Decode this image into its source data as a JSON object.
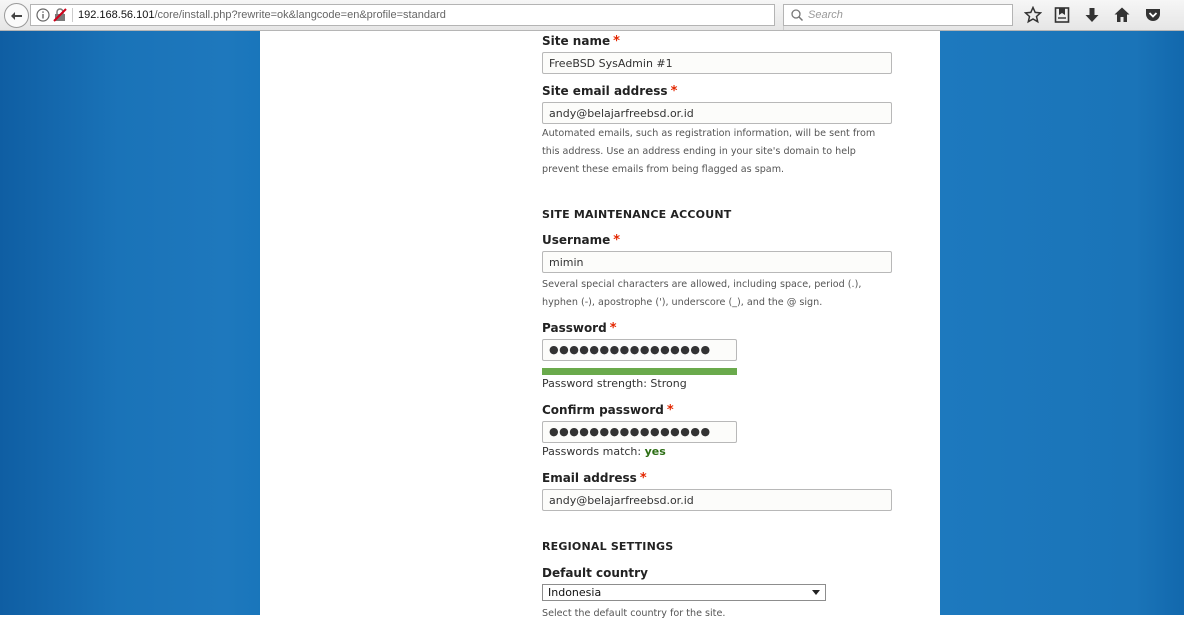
{
  "browser": {
    "url_host": "192.168.56.101",
    "url_path": "/core/install.php?rewrite=ok&langcode=en&profile=standard",
    "search_placeholder": "Search"
  },
  "form": {
    "site_name": {
      "label": "Site name",
      "required_mark": "*",
      "value": "FreeBSD SysAdmin #1"
    },
    "site_email": {
      "label": "Site email address",
      "required_mark": "*",
      "value": "andy@belajarfreebsd.or.id",
      "help_lines": [
        "Automated emails, such as registration information, will be sent from",
        "this address. Use an address ending in your site's domain to help",
        "prevent these emails from being flagged as spam."
      ]
    },
    "maintenance_heading": "SITE MAINTENANCE ACCOUNT",
    "username": {
      "label": "Username",
      "required_mark": "*",
      "value": "mimin",
      "help_lines": [
        "Several special characters are allowed, including space, period (.),",
        "hyphen (-), apostrophe ('), underscore (_), and the @ sign."
      ]
    },
    "password": {
      "label": "Password",
      "required_mark": "*",
      "value": "●●●●●●●●●●●●●●●●",
      "strength_text": "Password strength: Strong",
      "strength_level": 1.0
    },
    "confirm_password": {
      "label": "Confirm password",
      "required_mark": "*",
      "value": "●●●●●●●●●●●●●●●●",
      "match_prefix": "Passwords match: ",
      "match_value": "yes"
    },
    "email": {
      "label": "Email address",
      "required_mark": "*",
      "value": "andy@belajarfreebsd.or.id"
    },
    "regional_heading": "REGIONAL SETTINGS",
    "default_country": {
      "label": "Default country",
      "value": "Indonesia",
      "help": "Select the default country for the site."
    }
  },
  "colors": {
    "background_blue": "#1976bb",
    "required_red": "#e32700",
    "strength_green": "#6aaa4c",
    "match_green": "#2b6d13"
  },
  "icons": [
    "back-arrow-icon",
    "info-icon",
    "insecure-lock-icon",
    "reload-icon",
    "search-icon",
    "bookmark-star-icon",
    "reading-list-icon",
    "download-icon",
    "home-icon",
    "pocket-icon"
  ]
}
